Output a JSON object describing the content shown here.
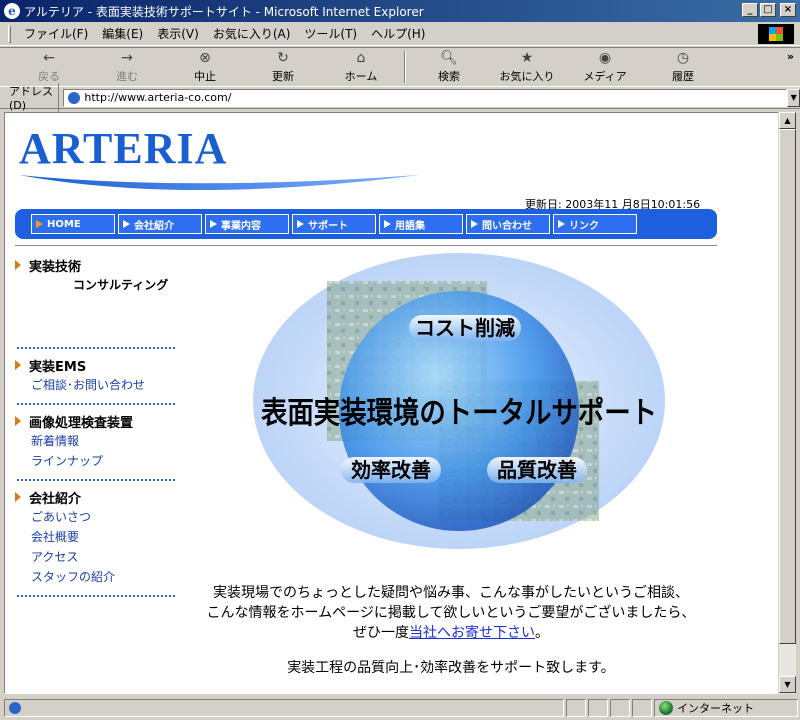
{
  "window": {
    "title": "アルテリア - 表面実装技術サポートサイト - Microsoft Internet Explorer",
    "ie_glyph": "e"
  },
  "menu": [
    "ファイル(F)",
    "編集(E)",
    "表示(V)",
    "お気に入り(A)",
    "ツール(T)",
    "ヘルプ(H)"
  ],
  "toolbar": {
    "back": "戻る",
    "forward": "進む",
    "stop": "中止",
    "refresh": "更新",
    "home": "ホーム",
    "search": "検索",
    "favorites": "お気に入り",
    "media": "メディア",
    "history": "履歴",
    "more": "»"
  },
  "address": {
    "label": "アドレス(D)",
    "url": "http://www.arteria-co.com/"
  },
  "page": {
    "logo": "ARTERIA",
    "updated": "更新日: 2003年11 月8日10:01:56",
    "nav": [
      "HOME",
      "会社紹介",
      "事業内容",
      "サポート",
      "用語集",
      "問い合わせ",
      "リンク"
    ],
    "side": {
      "s1_title": "実装技術",
      "s1_sub": "コンサルティング",
      "s2_title": "実装EMS",
      "s2_link": "ご相談･お問い合わせ",
      "s3_title": "画像処理検査装置",
      "s3_links": [
        "新着情報",
        "ラインナップ"
      ],
      "s4_title": "会社紹介",
      "s4_links": [
        "ごあいさつ",
        "会社概要",
        "アクセス",
        "スタッフの紹介"
      ]
    },
    "hero": {
      "cost": "コスト削減",
      "main": "表面実装環境のトータルサポート",
      "efficiency": "効率改善",
      "quality": "品質改善"
    },
    "message": {
      "line1": "実装現場でのちょっとした疑問や悩み事、こんな事がしたいというご相談、",
      "line2": "こんな情報をホームページに掲載して欲しいというご要望がございましたら、",
      "line3_pre": "ぜひ一度",
      "line3_link": "当社へお寄せ下さい",
      "line3_post": "。",
      "line4": "実装工程の品質向上･効率改善をサポート致します。"
    }
  },
  "status": {
    "zone": "インターネット"
  },
  "colors": {
    "brand_blue": "#1e5fe0",
    "link_blue": "#1a3fa8",
    "bullet_orange": "#e07a10"
  }
}
